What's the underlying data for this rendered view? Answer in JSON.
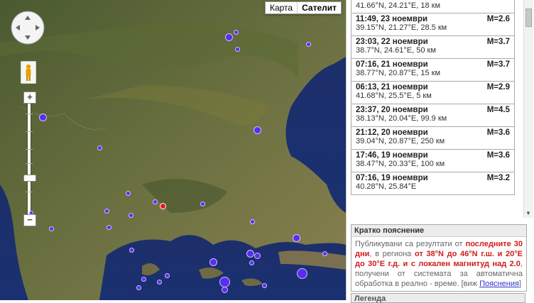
{
  "map": {
    "type_buttons": [
      {
        "label": "Карта",
        "active": false
      },
      {
        "label": "Сателит",
        "active": true
      }
    ],
    "zoom_in_label": "+",
    "zoom_out_label": "−",
    "controls": {
      "pan": "pan-control",
      "street_view": "pegman-icon"
    },
    "marker_color": "#5a2df0",
    "highlight_color": "#e41b1b"
  },
  "list": [
    {
      "time": "",
      "coords": "41.66°N, 24.21°E, 18 км",
      "mag": ""
    },
    {
      "time": "11:49, 23 ноември",
      "coords": "39.15°N, 21.27°E, 28.5 км",
      "mag": "M=2.6"
    },
    {
      "time": "23:03, 22 ноември",
      "coords": "38.7°N, 24.61°E, 50 км",
      "mag": "M=3.7"
    },
    {
      "time": "07:16, 21 ноември",
      "coords": "38.77°N, 20.87°E, 15 км",
      "mag": "M=3.7"
    },
    {
      "time": "06:13, 21 ноември",
      "coords": "41.68°N, 25.5°E, 5 км",
      "mag": "M=2.9"
    },
    {
      "time": "23:37, 20 ноември",
      "coords": "38.13°N, 20.04°E, 99.9 км",
      "mag": "M=4.5"
    },
    {
      "time": "21:12, 20 ноември",
      "coords": "39.04°N, 20.87°E, 250 км",
      "mag": "M=3.6"
    },
    {
      "time": "17:46, 19 ноември",
      "coords": "38.47°N, 20.33°E, 100 км",
      "mag": "M=3.6"
    },
    {
      "time": "07:16, 19 ноември",
      "coords": "40.28°N, 25.84°E",
      "mag": "M=3.2"
    }
  ],
  "explain": {
    "title": "Кратко пояснение",
    "p1": "Публикувани са резултати от ",
    "h1": "последните 30 дни",
    "p2": ", в региона ",
    "h2": "от 38°N до 46°N г.ш. и 20°E до 30°E г.д. и с локален магнитуд над 2.0",
    "p3": ", получени от системата за автоматична обработка в реално - време. [виж ",
    "link": "Пояснения",
    "p4": "]"
  },
  "legend": {
    "title": "Легенда"
  }
}
